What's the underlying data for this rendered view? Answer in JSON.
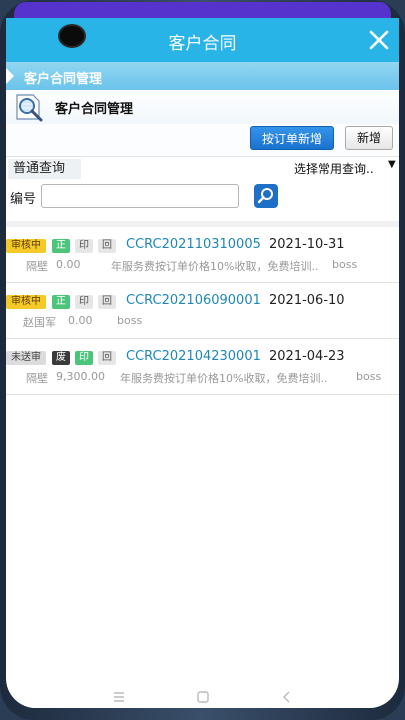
{
  "header": {
    "title": "客户合同"
  },
  "breadcrumb": {
    "text": "客户合同管理"
  },
  "module": {
    "title": "客户合同管理"
  },
  "actions": {
    "add_by_order": "按订单新增",
    "add": "新增"
  },
  "query": {
    "tab": "普通查询",
    "select": "选择常用查询.."
  },
  "search": {
    "label": "编号",
    "value": "",
    "placeholder": ""
  },
  "contracts": [
    {
      "status": "审核中",
      "type": "正",
      "print": "印",
      "back": "回",
      "code": "CCRC202110310005",
      "date": "2021-10-31",
      "customer": "隔壁",
      "amount": "0.00",
      "description": "年服务费按订单价格10%收取，免费培训..",
      "owner": "boss"
    },
    {
      "status": "审核中",
      "type": "正",
      "print": "印",
      "back": "回",
      "code": "CCRC202106090001",
      "date": "2021-06-10",
      "customer": "赵国军",
      "amount": "0.00",
      "description": "",
      "owner": "boss"
    },
    {
      "status": "未送审",
      "type": "废",
      "print": "印",
      "back": "回",
      "code": "CCRC202104230001",
      "date": "2021-04-23",
      "customer": "隔壁",
      "amount": "9,300.00",
      "description": "年服务费按订单价格10%收取，免费培训..",
      "owner": "boss"
    }
  ],
  "colors": {
    "header": "#29b4e8",
    "badge_review": "#f5c928",
    "badge_green": "#4cc57a",
    "badge_dark": "#3a3a3a",
    "link": "#1e87b8",
    "primary_button": "#1a72cf"
  },
  "icons": [
    "close-icon",
    "chevron-right-icon",
    "contract-magnifier-icon",
    "search-icon",
    "menu-icon",
    "home-icon",
    "back-icon"
  ]
}
